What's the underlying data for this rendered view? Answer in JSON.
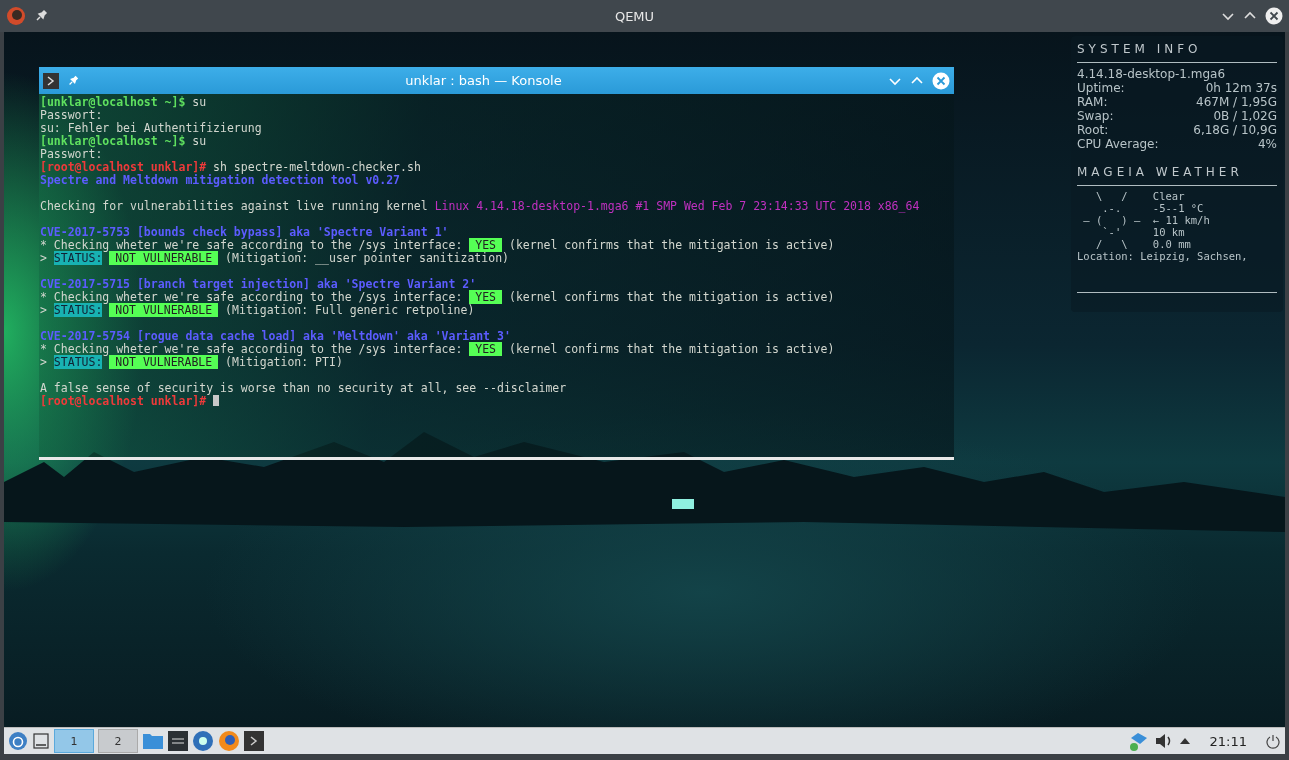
{
  "window": {
    "title": "QEMU"
  },
  "konsole": {
    "title": "unklar : bash — Konsole",
    "lines": [
      {
        "kind": "text",
        "segments": [
          {
            "kind": "user-prompt",
            "text": "[unklar@localhost ~]$"
          },
          {
            "kind": "plain",
            "text": " su"
          }
        ]
      },
      {
        "kind": "text",
        "segments": [
          {
            "kind": "plain",
            "text": "Passwort:"
          }
        ]
      },
      {
        "kind": "text",
        "segments": [
          {
            "kind": "plain",
            "text": "su: Fehler bei Authentifizierung"
          }
        ]
      },
      {
        "kind": "text",
        "segments": [
          {
            "kind": "user-prompt",
            "text": "[unklar@localhost ~]$"
          },
          {
            "kind": "plain",
            "text": " su"
          }
        ]
      },
      {
        "kind": "text",
        "segments": [
          {
            "kind": "plain",
            "text": "Passwort:"
          }
        ]
      },
      {
        "kind": "text",
        "segments": [
          {
            "kind": "root-prompt",
            "text": "[root@localhost unklar]#"
          },
          {
            "kind": "plain",
            "text": " sh spectre-meltdown-checker.sh"
          }
        ]
      },
      {
        "kind": "text",
        "segments": [
          {
            "kind": "heading",
            "text": "Spectre and Meltdown mitigation detection tool v0.27"
          }
        ]
      },
      {
        "kind": "blank"
      },
      {
        "kind": "text",
        "segments": [
          {
            "kind": "plain",
            "text": "Checking for vulnerabilities against live running kernel "
          },
          {
            "kind": "kernel",
            "text": "Linux 4.14.18-desktop-1.mga6 #1 SMP Wed Feb 7 23:14:33 UTC 2018 x86_64"
          }
        ]
      },
      {
        "kind": "blank"
      },
      {
        "kind": "text",
        "segments": [
          {
            "kind": "heading",
            "text": "CVE-2017-5753 [bounds check bypass] aka 'Spectre Variant 1'"
          }
        ]
      },
      {
        "kind": "text",
        "segments": [
          {
            "kind": "plain",
            "text": "* Checking wheter we're safe according to the /sys interface: "
          },
          {
            "kind": "yes",
            "text": "YES"
          },
          {
            "kind": "plain",
            "text": " (kernel confirms that the mitigation is active)"
          }
        ]
      },
      {
        "kind": "text",
        "segments": [
          {
            "kind": "plain",
            "text": "> "
          },
          {
            "kind": "status",
            "text": "STATUS:"
          },
          {
            "kind": "verdict",
            "text": "NOT VULNERABLE"
          },
          {
            "kind": "plain",
            "text": " (Mitigation: __user pointer sanitization)"
          }
        ]
      },
      {
        "kind": "blank"
      },
      {
        "kind": "text",
        "segments": [
          {
            "kind": "heading",
            "text": "CVE-2017-5715 [branch target injection] aka 'Spectre Variant 2'"
          }
        ]
      },
      {
        "kind": "text",
        "segments": [
          {
            "kind": "plain",
            "text": "* Checking wheter we're safe according to the /sys interface: "
          },
          {
            "kind": "yes",
            "text": "YES"
          },
          {
            "kind": "plain",
            "text": " (kernel confirms that the mitigation is active)"
          }
        ]
      },
      {
        "kind": "text",
        "segments": [
          {
            "kind": "plain",
            "text": "> "
          },
          {
            "kind": "status",
            "text": "STATUS:"
          },
          {
            "kind": "verdict",
            "text": "NOT VULNERABLE"
          },
          {
            "kind": "plain",
            "text": " (Mitigation: Full generic retpoline)"
          }
        ]
      },
      {
        "kind": "blank"
      },
      {
        "kind": "text",
        "segments": [
          {
            "kind": "heading",
            "text": "CVE-2017-5754 [rogue data cache load] aka 'Meltdown' aka 'Variant 3'"
          }
        ]
      },
      {
        "kind": "text",
        "segments": [
          {
            "kind": "plain",
            "text": "* Checking wheter we're safe according to the /sys interface: "
          },
          {
            "kind": "yes",
            "text": "YES"
          },
          {
            "kind": "plain",
            "text": " (kernel confirms that the mitigation is active)"
          }
        ]
      },
      {
        "kind": "text",
        "segments": [
          {
            "kind": "plain",
            "text": "> "
          },
          {
            "kind": "status",
            "text": "STATUS:"
          },
          {
            "kind": "verdict",
            "text": "NOT VULNERABLE"
          },
          {
            "kind": "plain",
            "text": " (Mitigation: PTI)"
          }
        ]
      },
      {
        "kind": "blank"
      },
      {
        "kind": "text",
        "segments": [
          {
            "kind": "plain",
            "text": "A false sense of security is worse than no security at all, see --disclaimer"
          }
        ]
      },
      {
        "kind": "cursor",
        "segments": [
          {
            "kind": "root-prompt",
            "text": "[root@localhost unklar]#"
          }
        ]
      }
    ]
  },
  "system_info": {
    "title": "SYSTEM INFO",
    "kernel": "4.14.18-desktop-1.mga6",
    "rows": [
      {
        "label": "Uptime:",
        "value": "0h 12m 37s"
      },
      {
        "label": "RAM:",
        "value": "467M / 1,95G"
      },
      {
        "label": "Swap:",
        "value": "0B / 1,02G"
      },
      {
        "label": "Root:",
        "value": "6,18G / 10,9G"
      },
      {
        "label": "CPU Average:",
        "value": "4%"
      }
    ]
  },
  "weather": {
    "title": "MAGEIA WEATHER",
    "lines": [
      {
        "art": "   \\   /    ",
        "text": "Clear"
      },
      {
        "art": "    .-.     ",
        "text": "-5--1 °C"
      },
      {
        "art": " ― (   ) ―  ",
        "text": "← 11 km/h"
      },
      {
        "art": "    `-'     ",
        "text": "10 km"
      },
      {
        "art": "   /   \\    ",
        "text": "0.0 mm"
      }
    ],
    "location": "Location: Leipzig, Sachsen,"
  },
  "taskbar": {
    "desktops": [
      {
        "label": "1",
        "selected": true
      },
      {
        "label": "2",
        "selected": false
      }
    ],
    "clock": "21:11"
  }
}
